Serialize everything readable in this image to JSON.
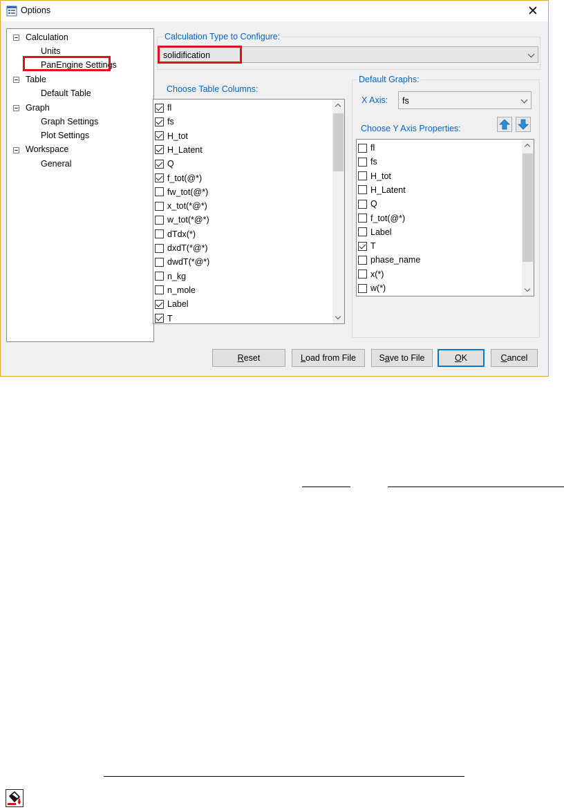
{
  "window": {
    "title": "Options",
    "close_glyph": "✕"
  },
  "tree": {
    "calculation": "Calculation",
    "units": "Units",
    "panengine_settings": "PanEngine Settings",
    "table": "Table",
    "default_table": "Default Table",
    "graph": "Graph",
    "graph_settings": "Graph Settings",
    "plot_settings": "Plot Settings",
    "workspace": "Workspace",
    "general": "General"
  },
  "calc_type": {
    "label": "Calculation Type to Configure:",
    "value": "solidification"
  },
  "table_columns": {
    "label": "Choose Table Columns:",
    "items": [
      {
        "label": "fl",
        "checked": true
      },
      {
        "label": "fs",
        "checked": true
      },
      {
        "label": "H_tot",
        "checked": true
      },
      {
        "label": "H_Latent",
        "checked": true
      },
      {
        "label": "Q",
        "checked": true
      },
      {
        "label": "f_tot(@*)",
        "checked": true
      },
      {
        "label": "fw_tot(@*)",
        "checked": false
      },
      {
        "label": "x_tot(*@*)",
        "checked": false
      },
      {
        "label": "w_tot(*@*)",
        "checked": false
      },
      {
        "label": "dTdx(*)",
        "checked": false
      },
      {
        "label": "dxdT(*@*)",
        "checked": false
      },
      {
        "label": "dwdT(*@*)",
        "checked": false
      },
      {
        "label": "n_kg",
        "checked": false
      },
      {
        "label": "n_mole",
        "checked": false
      },
      {
        "label": "Label",
        "checked": true
      },
      {
        "label": "T",
        "checked": true
      }
    ]
  },
  "default_graphs": {
    "label": "Default Graphs:",
    "x_axis_label": "X Axis:",
    "x_axis_value": "fs",
    "y_axis_label": "Choose Y Axis Properties:",
    "y_items": [
      {
        "label": "fl",
        "checked": false
      },
      {
        "label": "fs",
        "checked": false
      },
      {
        "label": "H_tot",
        "checked": false
      },
      {
        "label": "H_Latent",
        "checked": false
      },
      {
        "label": "Q",
        "checked": false
      },
      {
        "label": "f_tot(@*)",
        "checked": false
      },
      {
        "label": "Label",
        "checked": false
      },
      {
        "label": "T",
        "checked": true
      },
      {
        "label": "phase_name",
        "checked": false
      },
      {
        "label": "x(*)",
        "checked": false
      },
      {
        "label": "w(*)",
        "checked": false
      }
    ]
  },
  "buttons": {
    "reset_first": "R",
    "reset_rest": "eset",
    "load_first": "L",
    "load_rest": "oad from File",
    "save_first": "S",
    "save_a": "a",
    "save_rest": "ve to File",
    "ok_first": "O",
    "ok_rest": "K",
    "cancel_first": "C",
    "cancel_rest": "ancel"
  },
  "icons": {
    "title": "options-window-icon",
    "up": "arrow-up-icon",
    "down": "arrow-down-icon",
    "page": "fill-bucket-icon"
  },
  "colors": {
    "accent": "#0078d7",
    "highlight_box": "#e0101a",
    "group_label": "#0066cc"
  }
}
